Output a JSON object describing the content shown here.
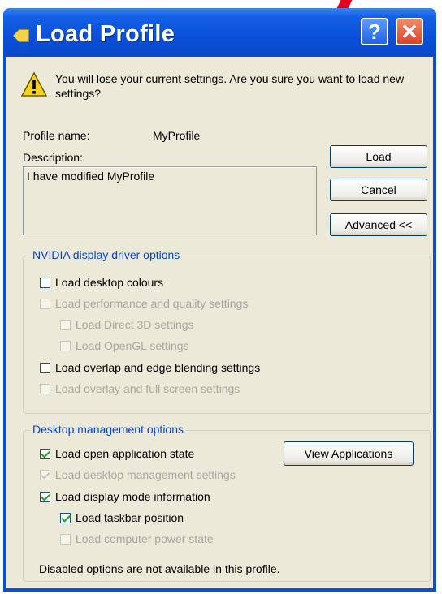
{
  "window": {
    "title": "Load Profile",
    "help_glyph": "?",
    "close_glyph": "✕"
  },
  "warning": {
    "icon": "warning-icon",
    "text": "You will lose your current settings. Are you sure you want to load new settings?"
  },
  "profile": {
    "name_label": "Profile name:",
    "name_value": "MyProfile",
    "description_label": "Description:",
    "description_value": "I have modified MyProfile"
  },
  "buttons": {
    "load": "Load",
    "cancel": "Cancel",
    "advanced": "Advanced <<",
    "view_applications": "View Applications"
  },
  "nvidia_group": {
    "legend": "NVIDIA display driver options",
    "items": [
      {
        "label": "Load desktop colours",
        "checked": false,
        "enabled": true
      },
      {
        "label": "Load performance and quality settings",
        "checked": false,
        "enabled": false
      },
      {
        "label": "Load Direct 3D settings",
        "checked": false,
        "enabled": false
      },
      {
        "label": "Load OpenGL settings",
        "checked": false,
        "enabled": false
      },
      {
        "label": "Load overlap and edge blending settings",
        "checked": false,
        "enabled": true
      },
      {
        "label": "Load overlay and full screen settings",
        "checked": false,
        "enabled": false
      }
    ]
  },
  "desktop_group": {
    "legend": "Desktop management options",
    "items": [
      {
        "label": "Load open application state",
        "checked": true,
        "enabled": true
      },
      {
        "label": "Load desktop management settings",
        "checked": true,
        "enabled": false
      },
      {
        "label": "Load display mode information",
        "checked": true,
        "enabled": true
      },
      {
        "label": "Load taskbar position",
        "checked": true,
        "enabled": true
      },
      {
        "label": "Load computer power state",
        "checked": false,
        "enabled": false
      }
    ],
    "footnote": "Disabled options are not available in this profile."
  }
}
